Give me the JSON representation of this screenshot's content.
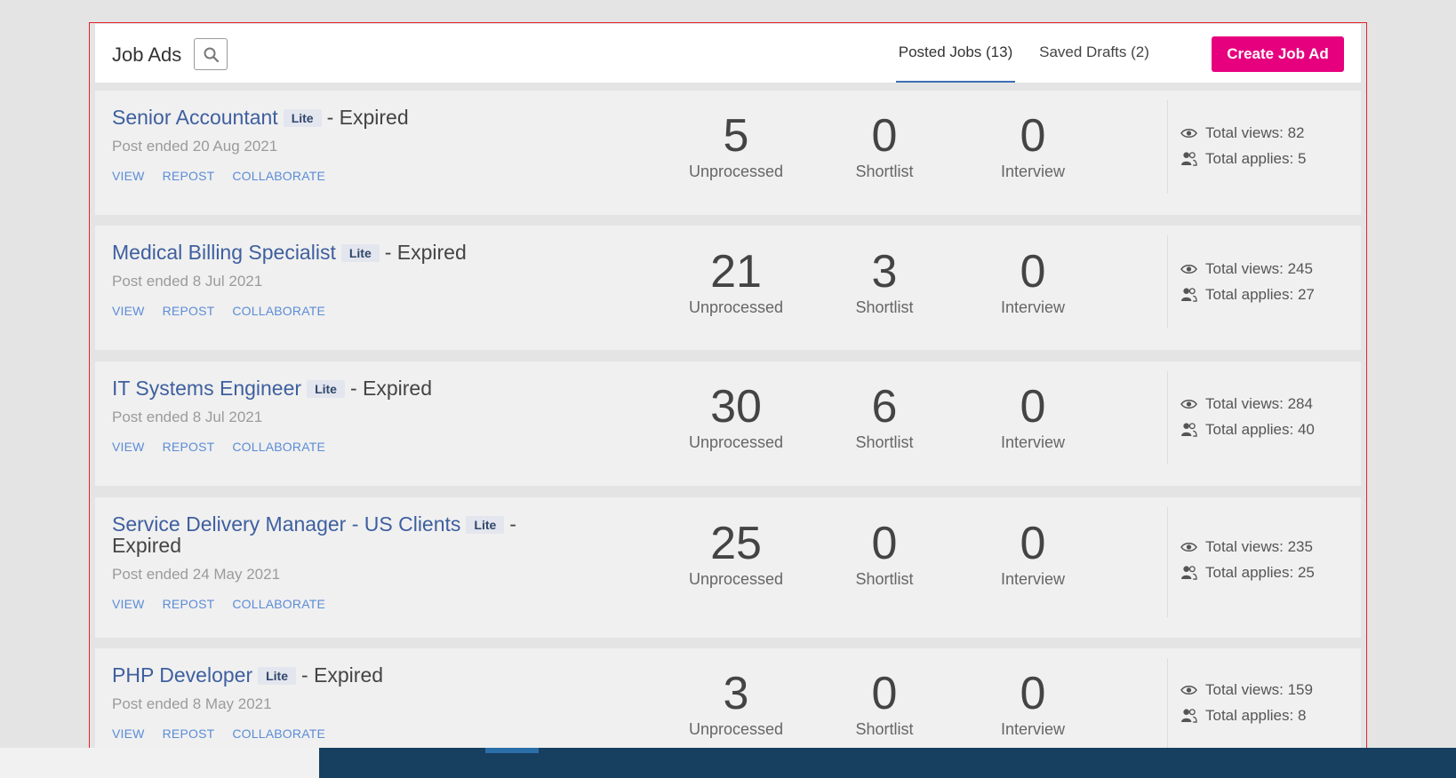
{
  "header": {
    "title": "Job Ads",
    "tabs": [
      {
        "label": "Posted Jobs (13)",
        "active": true
      },
      {
        "label": "Saved Drafts (2)",
        "active": false
      }
    ],
    "create_label": "Create Job Ad"
  },
  "colors": {
    "accent": "#e6007e",
    "link": "#3e5f9f",
    "action_link": "#5b8cd6",
    "frame_border": "#e0232a"
  },
  "jobs": [
    {
      "title": "Senior Accountant",
      "badge": "Lite",
      "status": "- Expired",
      "post_ended": "Post ended 20 Aug 2021",
      "actions": [
        "VIEW",
        "REPOST",
        "COLLABORATE"
      ],
      "stats": [
        {
          "value": "5",
          "label": "Unprocessed"
        },
        {
          "value": "0",
          "label": "Shortlist"
        },
        {
          "value": "0",
          "label": "Interview"
        }
      ],
      "views": "Total views: 82",
      "applies": "Total applies: 5"
    },
    {
      "title": "Medical Billing Specialist",
      "badge": "Lite",
      "status": "- Expired",
      "post_ended": "Post ended 8 Jul 2021",
      "actions": [
        "VIEW",
        "REPOST",
        "COLLABORATE"
      ],
      "stats": [
        {
          "value": "21",
          "label": "Unprocessed"
        },
        {
          "value": "3",
          "label": "Shortlist"
        },
        {
          "value": "0",
          "label": "Interview"
        }
      ],
      "views": "Total views: 245",
      "applies": "Total applies: 27"
    },
    {
      "title": "IT Systems Engineer",
      "badge": "Lite",
      "status": "- Expired",
      "post_ended": "Post ended 8 Jul 2021",
      "actions": [
        "VIEW",
        "REPOST",
        "COLLABORATE"
      ],
      "stats": [
        {
          "value": "30",
          "label": "Unprocessed"
        },
        {
          "value": "6",
          "label": "Shortlist"
        },
        {
          "value": "0",
          "label": "Interview"
        }
      ],
      "views": "Total views: 284",
      "applies": "Total applies: 40"
    },
    {
      "title": "Service Delivery Manager - US Clients",
      "badge": "Lite",
      "status": "- Expired",
      "post_ended": "Post ended 24 May 2021",
      "actions": [
        "VIEW",
        "REPOST",
        "COLLABORATE"
      ],
      "stats": [
        {
          "value": "25",
          "label": "Unprocessed"
        },
        {
          "value": "0",
          "label": "Shortlist"
        },
        {
          "value": "0",
          "label": "Interview"
        }
      ],
      "views": "Total views: 235",
      "applies": "Total applies: 25"
    },
    {
      "title": "PHP Developer",
      "badge": "Lite",
      "status": "- Expired",
      "post_ended": "Post ended 8 May 2021",
      "actions": [
        "VIEW",
        "REPOST",
        "COLLABORATE"
      ],
      "stats": [
        {
          "value": "3",
          "label": "Unprocessed"
        },
        {
          "value": "0",
          "label": "Shortlist"
        },
        {
          "value": "0",
          "label": "Interview"
        }
      ],
      "views": "Total views: 159",
      "applies": "Total applies: 8"
    }
  ]
}
